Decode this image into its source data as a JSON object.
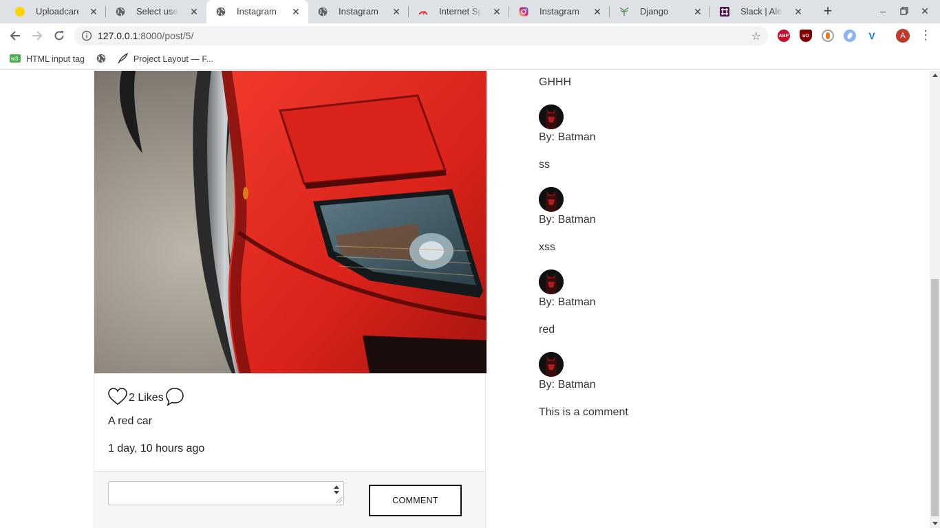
{
  "browser": {
    "tabs": [
      {
        "title": "Uploadcare",
        "icon": "uploadcare-icon",
        "active": false
      },
      {
        "title": "Select user to c",
        "icon": "globe-icon",
        "active": false
      },
      {
        "title": "Instagram",
        "icon": "globe-icon",
        "active": true
      },
      {
        "title": "Instagram",
        "icon": "globe-icon",
        "active": false
      },
      {
        "title": "Internet Speed",
        "icon": "speedtest-icon",
        "active": false
      },
      {
        "title": "Instagram",
        "icon": "instagram-icon",
        "active": false
      },
      {
        "title": "Django",
        "icon": "django-icon",
        "active": false
      },
      {
        "title": "Slack | Alexna",
        "icon": "slack-icon",
        "active": false
      }
    ],
    "new_tab": "+",
    "url_host": "127.0.0.1",
    "url_path": ":8000/post/5/",
    "profile_initial": "A",
    "extensions": [
      {
        "name": "adblock-plus-icon",
        "label": "ABP",
        "color": "#c70d2c"
      },
      {
        "name": "ublock-icon",
        "label": "uO",
        "color": "#800000"
      },
      {
        "name": "extension-orange-icon",
        "label": "",
        "color": "#e67e22"
      },
      {
        "name": "extension-blue-icon",
        "label": "",
        "color": "#5b8def"
      },
      {
        "name": "extension-v-icon",
        "label": "V",
        "color": "#1a73e8"
      }
    ],
    "bookmarks": [
      {
        "label": "HTML input tag",
        "icon": "w3schools-icon"
      },
      {
        "label": "",
        "icon": "globe-icon"
      },
      {
        "label": "Project Layout — F...",
        "icon": "feather-icon"
      }
    ]
  },
  "post": {
    "likes": "2 Likes",
    "caption": "A red car",
    "time": "1 day, 10 hours ago",
    "comment_button": "COMMENT",
    "comment_placeholder": ""
  },
  "comments": [
    {
      "text": "GHHH"
    },
    {
      "author": "By: Batman",
      "text": "ss"
    },
    {
      "author": "By: Batman",
      "text": "xss"
    },
    {
      "author": "By: Batman",
      "text": "red"
    },
    {
      "author": "By: Batman",
      "text": "This is a comment"
    }
  ],
  "colors": {
    "car_red": "#e0241b",
    "tabstrip": "#dee1e6",
    "button_border": "#111111"
  }
}
